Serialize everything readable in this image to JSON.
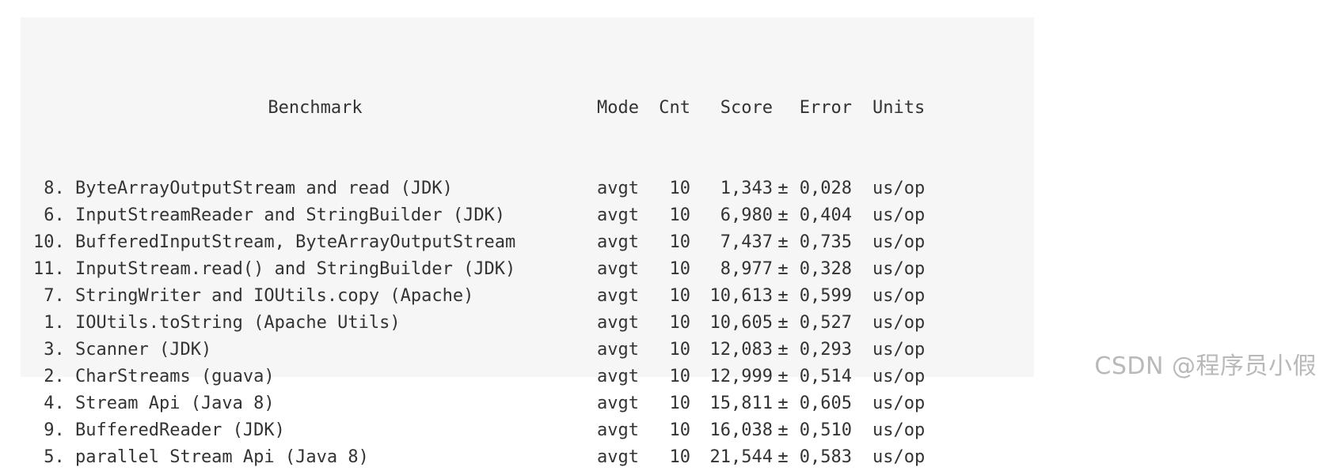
{
  "table": {
    "headers": {
      "benchmark": "Benchmark",
      "mode": "Mode",
      "cnt": "Cnt",
      "score": "Score",
      "error": "Error",
      "units": "Units"
    },
    "pm": "±",
    "rows": [
      {
        "num": " 8.",
        "name": "ByteArrayOutputStream and read (JDK)",
        "mode": "avgt",
        "cnt": "10",
        "score": "1,343",
        "error": "0,028",
        "units": "us/op"
      },
      {
        "num": " 6.",
        "name": "InputStreamReader and StringBuilder (JDK)",
        "mode": "avgt",
        "cnt": "10",
        "score": "6,980",
        "error": "0,404",
        "units": "us/op"
      },
      {
        "num": "10.",
        "name": "BufferedInputStream, ByteArrayOutputStream",
        "mode": "avgt",
        "cnt": "10",
        "score": "7,437",
        "error": "0,735",
        "units": "us/op"
      },
      {
        "num": "11.",
        "name": "InputStream.read() and StringBuilder (JDK)",
        "mode": "avgt",
        "cnt": "10",
        "score": "8,977",
        "error": "0,328",
        "units": "us/op"
      },
      {
        "num": " 7.",
        "name": "StringWriter and IOUtils.copy (Apache)",
        "mode": "avgt",
        "cnt": "10",
        "score": "10,613",
        "error": "0,599",
        "units": "us/op"
      },
      {
        "num": " 1.",
        "name": "IOUtils.toString (Apache Utils)",
        "mode": "avgt",
        "cnt": "10",
        "score": "10,605",
        "error": "0,527",
        "units": "us/op"
      },
      {
        "num": " 3.",
        "name": "Scanner (JDK)",
        "mode": "avgt",
        "cnt": "10",
        "score": "12,083",
        "error": "0,293",
        "units": "us/op"
      },
      {
        "num": " 2.",
        "name": "CharStreams (guava)",
        "mode": "avgt",
        "cnt": "10",
        "score": "12,999",
        "error": "0,514",
        "units": "us/op"
      },
      {
        "num": " 4.",
        "name": "Stream Api (Java 8)",
        "mode": "avgt",
        "cnt": "10",
        "score": "15,811",
        "error": "0,605",
        "units": "us/op"
      },
      {
        "num": " 9.",
        "name": "BufferedReader (JDK)",
        "mode": "avgt",
        "cnt": "10",
        "score": "16,038",
        "error": "0,510",
        "units": "us/op"
      },
      {
        "num": " 5.",
        "name": "parallel Stream Api (Java 8)",
        "mode": "avgt",
        "cnt": "10",
        "score": "21,544",
        "error": "0,583",
        "units": "us/op"
      }
    ]
  },
  "watermark": "CSDN @程序员小假"
}
